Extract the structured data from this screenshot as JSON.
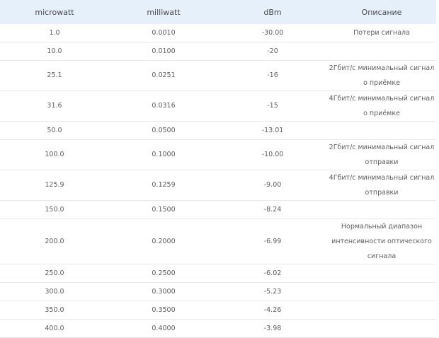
{
  "table": {
    "headers": [
      "microwatt",
      "milliwatt",
      "dBm",
      "Описание"
    ],
    "rows": [
      {
        "microwatt": "1.0",
        "milliwatt": "0.0010",
        "dbm": "-30.00",
        "desc": "Потери сигнала"
      },
      {
        "microwatt": "10.0",
        "milliwatt": "0.0100",
        "dbm": "-20",
        "desc": ""
      },
      {
        "microwatt": "25.1",
        "milliwatt": "0.0251",
        "dbm": "-16",
        "desc": "2Гбит/с минимальный сигнал о приёмке"
      },
      {
        "microwatt": "31.6",
        "milliwatt": "0.0316",
        "dbm": "-15",
        "desc": "4Гбит/с минимальный сигнал о приёмке"
      },
      {
        "microwatt": "50.0",
        "milliwatt": "0.0500",
        "dbm": "-13.01",
        "desc": ""
      },
      {
        "microwatt": "100.0",
        "milliwatt": "0.1000",
        "dbm": "-10.00",
        "desc": "2Гбит/с минимальный сигнал отправки"
      },
      {
        "microwatt": "125.9",
        "milliwatt": "0.1259",
        "dbm": "-9.00",
        "desc": "4Гбит/с минимальный сигнал отправки"
      },
      {
        "microwatt": "150.0",
        "milliwatt": "0.1500",
        "dbm": "-8.24",
        "desc": ""
      },
      {
        "microwatt": "200.0",
        "milliwatt": "0.2000",
        "dbm": "-6.99",
        "desc": "Нормальный диапазон интенсивности оптического сигнала"
      },
      {
        "microwatt": "250.0",
        "milliwatt": "0.2500",
        "dbm": "-6.02",
        "desc": ""
      },
      {
        "microwatt": "300.0",
        "milliwatt": "0.3000",
        "dbm": "-5.23",
        "desc": ""
      },
      {
        "microwatt": "350.0",
        "milliwatt": "0.3500",
        "dbm": "-4.26",
        "desc": ""
      },
      {
        "microwatt": "400.0",
        "milliwatt": "0.4000",
        "dbm": "-3.98",
        "desc": ""
      }
    ]
  }
}
